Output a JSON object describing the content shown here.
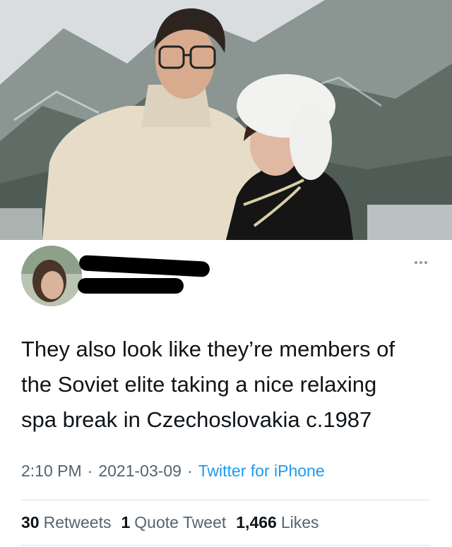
{
  "tweet": {
    "text": "They also look like they’re members of\nthe Soviet elite taking a nice relaxing\nspa break in Czechoslovakia c.1987",
    "time": "2:10 PM",
    "separator": "·",
    "date": "2021-03-09",
    "source": "Twitter for iPhone"
  },
  "stats": {
    "retweets_count": "30",
    "retweets_label": "Retweets",
    "quotes_count": "1",
    "quotes_label": "Quote Tweet",
    "likes_count": "1,466",
    "likes_label": "Likes"
  },
  "icons": {
    "more": "more-horizontal-icon"
  },
  "colors": {
    "link": "#1d9bf0",
    "secondary_text": "#536471",
    "divider": "#dde3e7"
  }
}
